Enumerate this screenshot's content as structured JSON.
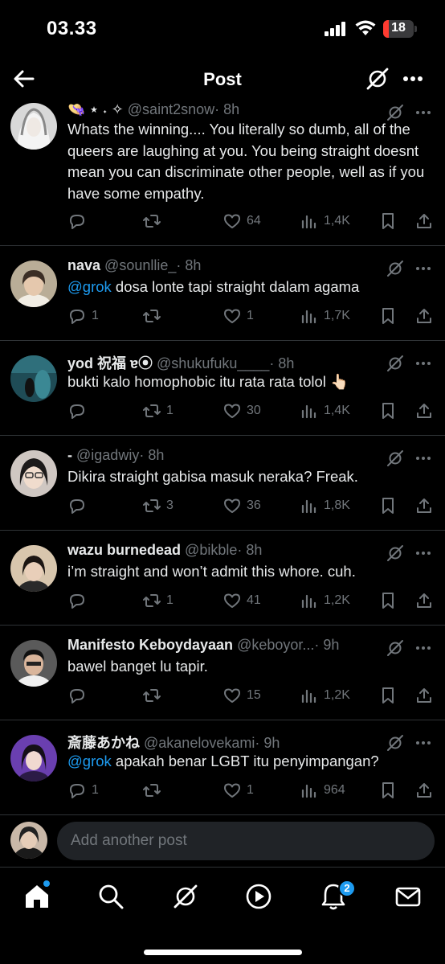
{
  "status_bar": {
    "time": "03.33",
    "battery": "18",
    "battery_level": 0.18
  },
  "header": {
    "title": "Post"
  },
  "posts": [
    {
      "name": "👒 ⋆ ˖ ✧",
      "handle": "@saint2snow",
      "time": "· 8h",
      "text": "Whats the winning.... You literally so dumb, all of the queers are laughing at you. You being straight doesnt mean you can discriminate other people, well as if you have some empathy.",
      "mention": "",
      "replies": "",
      "reposts": "",
      "likes": "64",
      "views": "1,4K"
    },
    {
      "name": "nava",
      "handle": "@sounllie_",
      "time": "· 8h",
      "text": " dosa lonte tapi straight dalam agama",
      "mention": "@grok",
      "replies": "1",
      "reposts": "",
      "likes": "1",
      "views": "1,7K"
    },
    {
      "name": "yod 祝福 ɐ⦿",
      "handle": "@shukufuku____",
      "time": "· 8h",
      "text": "bukti kalo homophobic itu rata rata tolol 👆🏻",
      "mention": "",
      "replies": "",
      "reposts": "1",
      "likes": "30",
      "views": "1,4K"
    },
    {
      "name": "-",
      "handle": "@igadwiy",
      "time": "· 8h",
      "text": "Dikira straight gabisa masuk neraka? Freak.",
      "mention": "",
      "replies": "",
      "reposts": "3",
      "likes": "36",
      "views": "1,8K"
    },
    {
      "name": "wazu burnedead",
      "handle": "@bikble",
      "time": "· 8h",
      "text": "i’m straight and won’t admit this whore. cuh.",
      "mention": "",
      "replies": "",
      "reposts": "1",
      "likes": "41",
      "views": "1,2K"
    },
    {
      "name": "Manifesto Keboydayaan",
      "handle": "@keboyor...",
      "time": "· 9h",
      "text": "bawel banget lu tapir.",
      "mention": "",
      "replies": "",
      "reposts": "",
      "likes": "15",
      "views": "1,2K"
    },
    {
      "name": "斎藤あかね",
      "handle": "@akanelovekami",
      "time": "· 9h",
      "text": " apakah benar LGBT itu penyimpangan?",
      "mention": "@grok",
      "replies": "1",
      "reposts": "",
      "likes": "1",
      "views": "964"
    }
  ],
  "compose": {
    "placeholder": "Add another post"
  },
  "bottom_nav": {
    "notifications_badge": "2"
  },
  "icons": {
    "back": "arrow-left-icon",
    "grok": "grok-icon",
    "more": "more-icon",
    "reply": "reply-icon",
    "repost": "repost-icon",
    "like": "heart-icon",
    "views": "views-icon",
    "bookmark": "bookmark-icon",
    "share": "share-icon",
    "home": "home-icon",
    "search": "search-icon",
    "play": "play-icon",
    "bell": "bell-icon",
    "mail": "mail-icon"
  },
  "colors": {
    "background": "#000000",
    "text": "#e7e9ea",
    "secondary": "#71767b",
    "accent": "#1d9bf0",
    "divider": "#2f3336"
  }
}
